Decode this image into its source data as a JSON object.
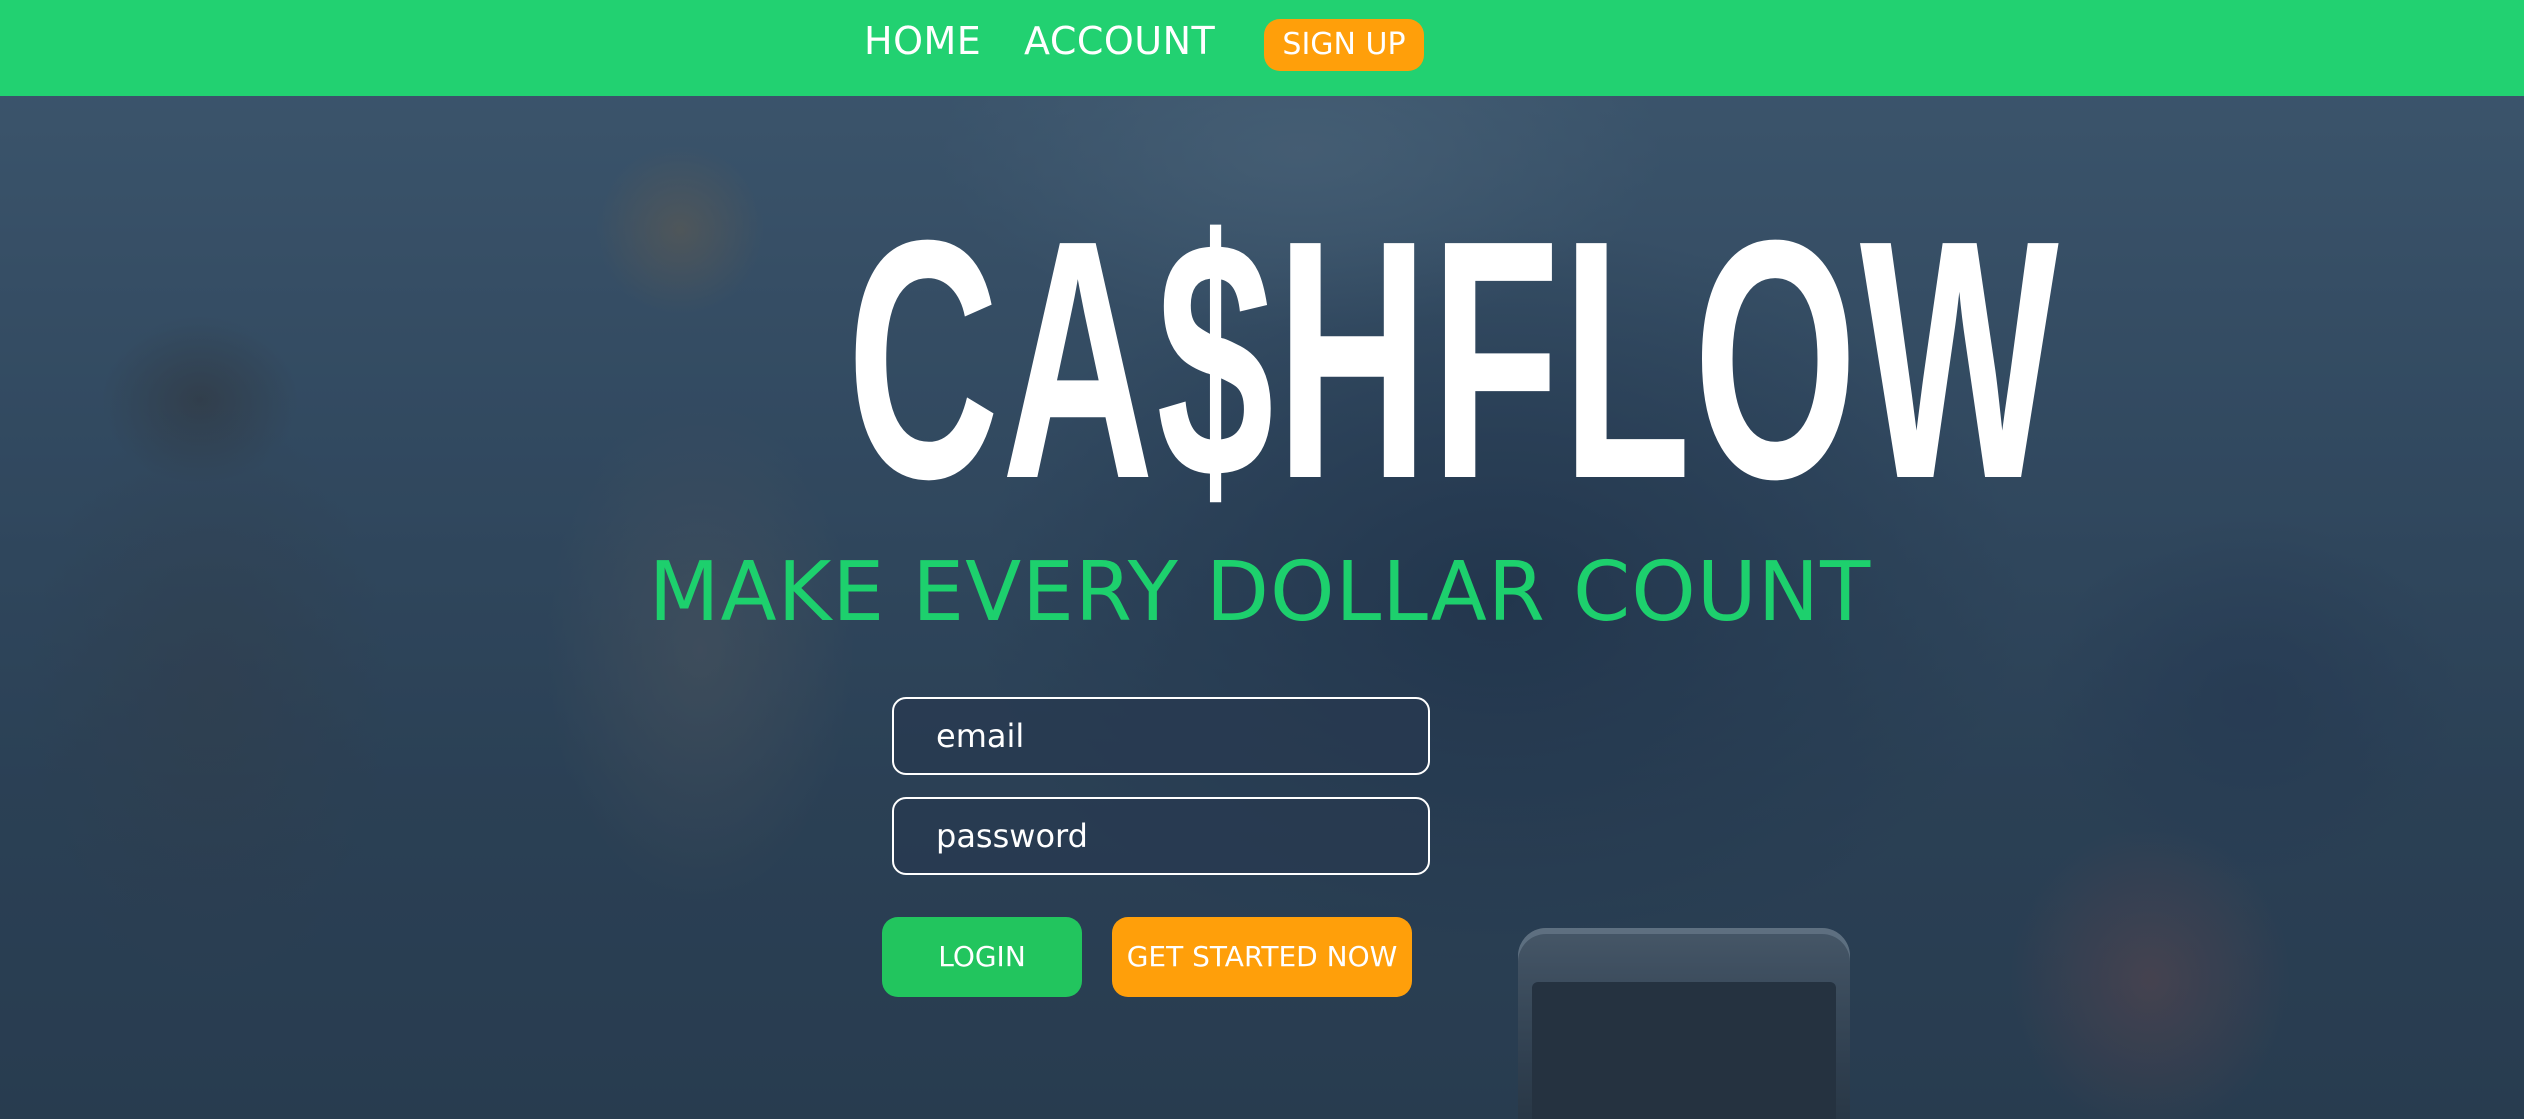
{
  "colors": {
    "navbar_bg": "#22d171",
    "accent_orange": "#ff9f0a",
    "tagline_green": "#1dd06d",
    "login_green": "#22c55e",
    "text_white": "#ffffff"
  },
  "nav": {
    "home": "HOME",
    "account": "ACCOUNT",
    "signup": "SIGN UP"
  },
  "hero": {
    "title": "CA$HFLOW",
    "tagline": "MAKE EVERY DOLLAR COUNT"
  },
  "form": {
    "email_placeholder": "email",
    "password_placeholder": "password",
    "login_label": "LOGIN",
    "get_started_label": "GET STARTED NOW"
  }
}
